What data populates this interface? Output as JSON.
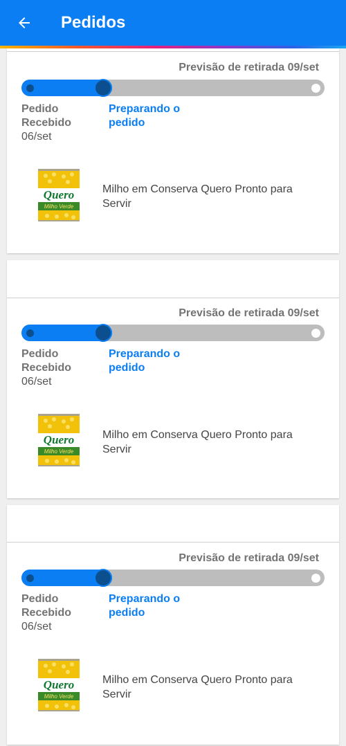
{
  "header": {
    "back_icon": "arrow-left-icon",
    "title": "Pedidos",
    "background": "#0a7ef2"
  },
  "orders": [
    {
      "forecast": "Previsão de retirada 09/set",
      "progress": 0.3,
      "steps": {
        "received_label": "Pedido Recebido",
        "received_date": "06/set",
        "current_label": "Preparando o pedido"
      },
      "product": {
        "name": "Milho em Conserva Quero Pronto para Servir",
        "brand": "Quero",
        "variant": "Milho Verde"
      }
    },
    {
      "forecast": "Previsão de retirada 09/set",
      "progress": 0.3,
      "steps": {
        "received_label": "Pedido Recebido",
        "received_date": "06/set",
        "current_label": "Preparando o pedido"
      },
      "product": {
        "name": "Milho em Conserva Quero Pronto para Servir",
        "brand": "Quero",
        "variant": "Milho Verde"
      }
    },
    {
      "forecast": "Previsão de retirada 09/set",
      "progress": 0.3,
      "steps": {
        "received_label": "Pedido Recebido",
        "received_date": "06/set",
        "current_label": "Preparando o pedido"
      },
      "product": {
        "name": "Milho em Conserva Quero Pronto para Servir",
        "brand": "Quero",
        "variant": "Milho Verde"
      }
    }
  ],
  "colors": {
    "accent": "#0a7ef2",
    "accent_dark": "#0b4f8e",
    "track": "#bdbdbd",
    "muted_text": "#737373"
  }
}
